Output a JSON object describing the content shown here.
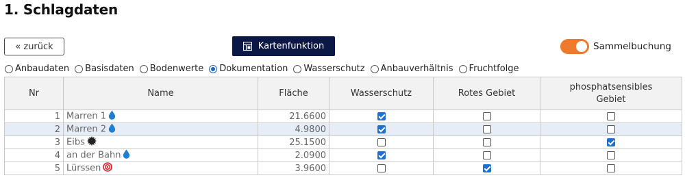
{
  "page": {
    "title": "1. Schlagdaten"
  },
  "toolbar": {
    "back_label": "« zurück",
    "map_label": "Kartenfunktion",
    "toggle_label": "Sammelbuchung",
    "toggle_on": true,
    "accent_color": "#f07a2b"
  },
  "tabs": [
    {
      "label": "Anbaudaten",
      "selected": false
    },
    {
      "label": "Basisdaten",
      "selected": false
    },
    {
      "label": "Bodenwerte",
      "selected": false
    },
    {
      "label": "Dokumentation",
      "selected": true
    },
    {
      "label": "Wasserschutz",
      "selected": false
    },
    {
      "label": "Anbauverhältnis",
      "selected": false
    },
    {
      "label": "Fruchtfolge",
      "selected": false
    }
  ],
  "table": {
    "headers": {
      "nr": "Nr",
      "name": "Name",
      "area": "Fläche",
      "water": "Wasserschutz",
      "red": "Rotes Gebiet",
      "phos_line1": "phosphatsensibles",
      "phos_line2": "Gebiet"
    },
    "rows": [
      {
        "nr": "1",
        "name": "Marren 1",
        "icon": "water-drop-icon",
        "area": "21.6600",
        "water": true,
        "red": false,
        "phos": false
      },
      {
        "nr": "2",
        "name": "Marren 2",
        "icon": "water-drop-icon",
        "area": "4.9800",
        "water": true,
        "red": false,
        "phos": false
      },
      {
        "nr": "3",
        "name": "Eibs",
        "icon": "gear-burst-icon",
        "area": "25.1500",
        "water": false,
        "red": false,
        "phos": true
      },
      {
        "nr": "4",
        "name": "an der Bahn",
        "icon": "water-drop-icon",
        "area": "2.0900",
        "water": true,
        "red": false,
        "phos": false
      },
      {
        "nr": "5",
        "name": "Lürssen",
        "icon": "target-icon",
        "area": "3.9600",
        "water": false,
        "red": true,
        "phos": false
      }
    ]
  }
}
